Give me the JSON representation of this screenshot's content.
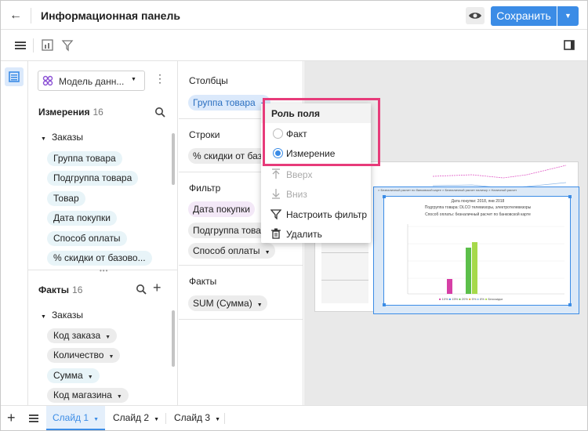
{
  "header": {
    "title": "Информационная панель",
    "save_label": "Сохранить"
  },
  "data_panel": {
    "model_label": "Модель данн...",
    "dimensions": {
      "title": "Измерения",
      "count": "16",
      "group": "Заказы",
      "items": [
        "Группа товара",
        "Подгруппа товара",
        "Товар",
        "Дата покупки",
        "Способ оплаты",
        "% скидки от базово..."
      ]
    },
    "facts": {
      "title": "Факты",
      "count": "16",
      "group": "Заказы",
      "items": [
        "Код заказа",
        "Количество",
        "Сумма",
        "Код магазина"
      ]
    }
  },
  "config": {
    "columns_title": "Столбцы",
    "columns_chip": "Группа товара",
    "rows_title": "Строки",
    "rows_chip": "% скидки от базово",
    "filter_title": "Фильтр",
    "filter_chips": [
      "Дата покупки",
      "Подгруппа товара",
      "Способ оплаты"
    ],
    "facts_title": "Факты",
    "facts_chip": "SUM (Сумма)"
  },
  "popup": {
    "title": "Роль поля",
    "options": [
      "Факт",
      "Измерение"
    ],
    "selected": "Измерение",
    "actions": [
      "Вверх",
      "Вниз",
      "Настроить фильтр",
      "Удалить"
    ]
  },
  "canvas_widget": {
    "filter_line_1": "Дата покупки: 2018, янв 2018",
    "filter_line_2": "Подгруппа товара: DLCO телевизоры, электротелевизоры",
    "filter_line_3": "Способ оплаты: безналичный расчет по банковской карте",
    "legend": [
      "10%",
      "15%",
      "20%",
      "5%",
      "8%",
      "Безскидки"
    ],
    "colors": {
      "accent": "#3b8ce6",
      "highlight": "#e73b7a",
      "bar_pink": "#d63fa6",
      "bar_green": "#5cbf4a",
      "bar_lime": "#a6d94a"
    }
  },
  "footer": {
    "tabs": [
      "Слайд 1",
      "Слайд 2",
      "Слайд 3"
    ],
    "active_tab": "Слайд 1"
  }
}
